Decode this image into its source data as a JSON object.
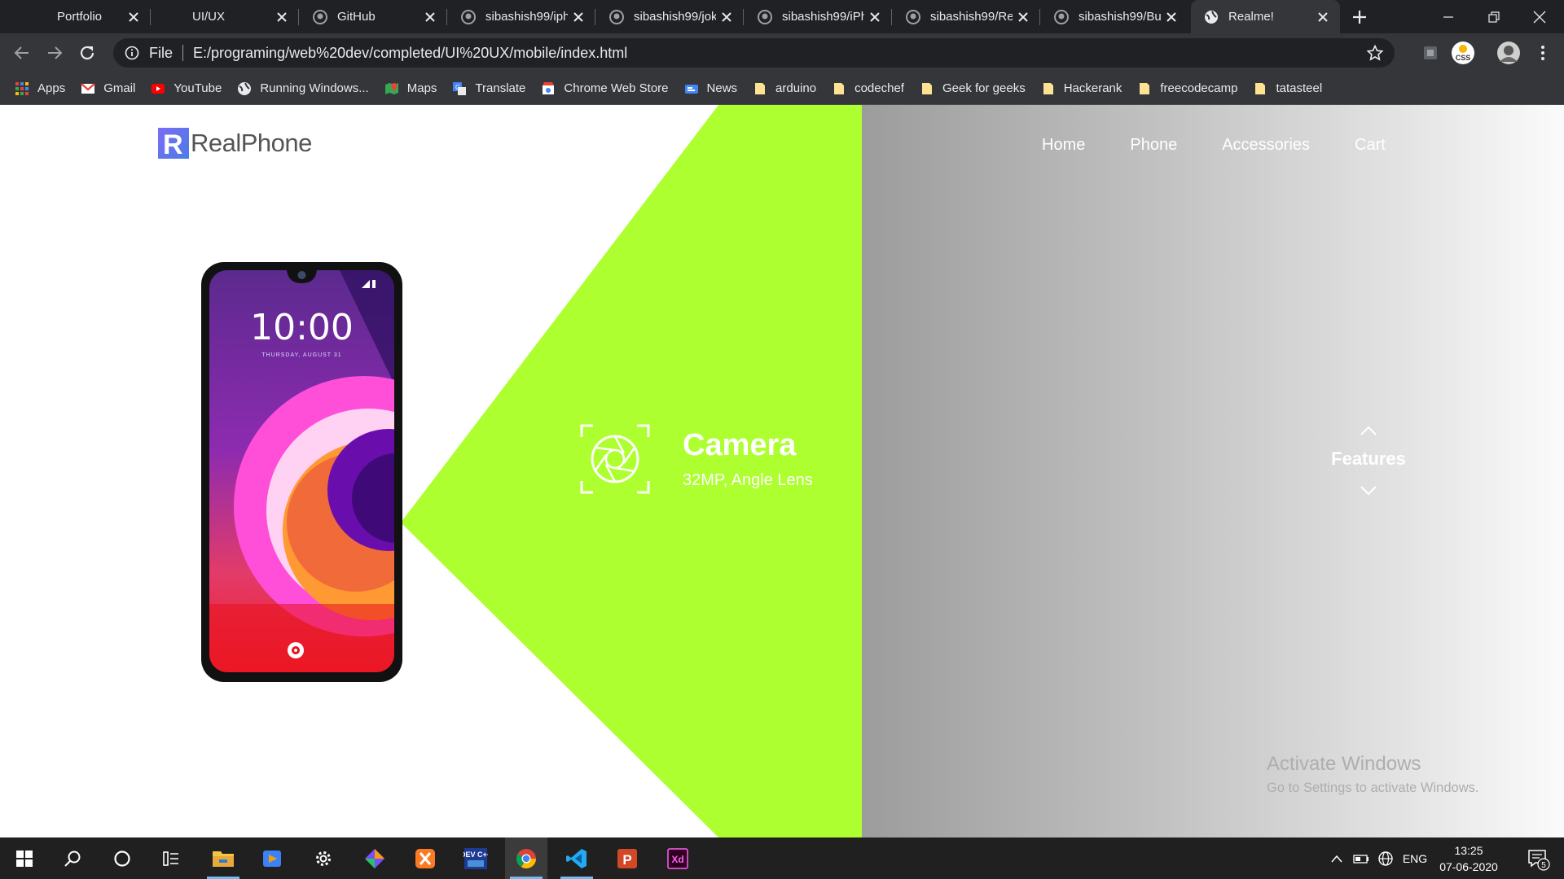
{
  "browser": {
    "tabs": [
      {
        "label": "Portfolio",
        "icon": "none",
        "active": false
      },
      {
        "label": "UI/UX",
        "icon": "none",
        "active": false
      },
      {
        "label": "GitHub",
        "icon": "github-icon",
        "active": false
      },
      {
        "label": "sibashish99/iph",
        "icon": "github-icon",
        "active": false
      },
      {
        "label": "sibashish99/jok",
        "icon": "github-icon",
        "active": false
      },
      {
        "label": "sibashish99/iPh",
        "icon": "github-icon",
        "active": false
      },
      {
        "label": "sibashish99/Re",
        "icon": "github-icon",
        "active": false
      },
      {
        "label": "sibashish99/Bu",
        "icon": "github-icon",
        "active": false
      },
      {
        "label": "Realme!",
        "icon": "globe-icon",
        "active": true
      }
    ],
    "address_scheme": "File",
    "address_url": "E:/programing/web%20dev/completed/UI%20UX/mobile/index.html",
    "bookmarks": [
      {
        "label": "Apps",
        "icon": "apps-grid-icon"
      },
      {
        "label": "Gmail",
        "icon": "gmail-icon"
      },
      {
        "label": "YouTube",
        "icon": "youtube-icon"
      },
      {
        "label": "Running Windows...",
        "icon": "globe-icon"
      },
      {
        "label": "Maps",
        "icon": "maps-icon"
      },
      {
        "label": "Translate",
        "icon": "translate-icon"
      },
      {
        "label": "Chrome Web Store",
        "icon": "web-store-icon"
      },
      {
        "label": "News",
        "icon": "news-icon"
      },
      {
        "label": "arduino",
        "icon": "folder-icon"
      },
      {
        "label": "codechef",
        "icon": "folder-icon"
      },
      {
        "label": "Geek for geeks",
        "icon": "folder-icon"
      },
      {
        "label": "Hackerank",
        "icon": "folder-icon"
      },
      {
        "label": "freecodecamp",
        "icon": "folder-icon"
      },
      {
        "label": "tatasteel",
        "icon": "folder-icon"
      }
    ],
    "extension_badge": "CSS"
  },
  "site": {
    "logo_letter": "R",
    "logo_text": "RealPhone",
    "nav": [
      "Home",
      "Phone",
      "Accessories",
      "Cart"
    ],
    "phone_screen": {
      "time": "10:00",
      "date": "THURSDAY, AUGUST 31"
    },
    "feature_title": "Camera",
    "feature_subtitle": "32MP, Angle Lens",
    "switcher_label": "Features",
    "colors": {
      "accent_green": "#adff2f",
      "gray_panel": "#9c9c9c",
      "logo_purple": "#6a5cf0"
    }
  },
  "watermark": {
    "line1": "Activate Windows",
    "line2": "Go to Settings to activate Windows."
  },
  "taskbar": {
    "apps": [
      "windows-start-icon",
      "search-icon",
      "cortana-icon",
      "task-view-icon",
      "file-explorer-icon",
      "media-player-icon",
      "settings-icon",
      "git-icon",
      "xampp-icon",
      "devc-icon",
      "chrome-icon",
      "vscode-icon",
      "powerpoint-icon",
      "adobe-xd-icon"
    ],
    "devc_label": "DEV C++",
    "xd_label": "Xd",
    "language": "ENG",
    "time": "13:25",
    "date": "07-06-2020",
    "notifications": "5"
  }
}
